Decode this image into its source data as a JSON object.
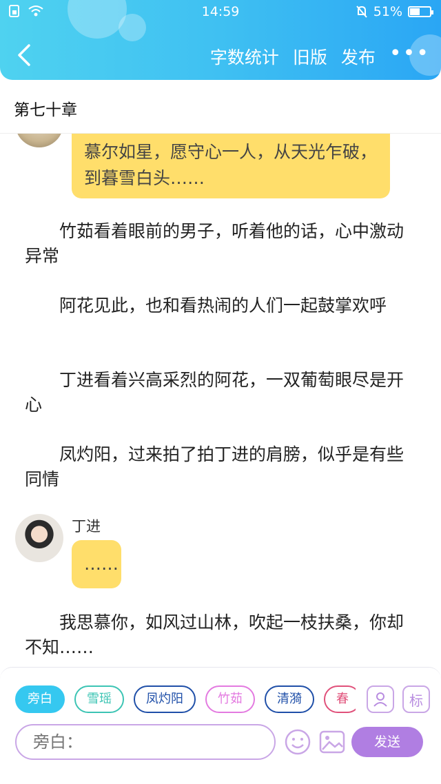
{
  "status_bar": {
    "time": "14:59",
    "battery": "51%",
    "battery_level": 0.51
  },
  "nav": {
    "actions": [
      "字数统计",
      "旧版",
      "发布"
    ],
    "more": "•••"
  },
  "chapter": {
    "title": "第七十章"
  },
  "messages": {
    "first_bubble": "慕尔如星，愿守心一人，从天光乍破，到暮雪白头……",
    "p1": "竹茹看着眼前的男子，听着他的话，心中激动异常",
    "p2": "阿花见此，也和看热闹的人们一起鼓掌欢呼",
    "p3": "丁进看着兴高采烈的阿花，一双葡萄眼尽是开心",
    "p4": "凤灼阳，过来拍了拍丁进的肩膀，似乎是有些同情",
    "speaker": "丁进",
    "speaker_bubble": "……",
    "p5": "我思慕你，如风过山林，吹起一枝扶桑，你却不知……"
  },
  "composer": {
    "chips": [
      {
        "label": "旁白",
        "color": "#35c8f0",
        "active": true
      },
      {
        "label": "雪瑶",
        "color": "#3cc4b4",
        "active": false
      },
      {
        "label": "凤灼阳",
        "color": "#1f4fa8",
        "active": false
      },
      {
        "label": "竹茹",
        "color": "#e37ae0",
        "active": false
      },
      {
        "label": "清漪",
        "color": "#1f4fa8",
        "active": false
      },
      {
        "label": "春",
        "color": "#e0507a",
        "active": false
      }
    ],
    "tag_icon_label": "标",
    "input_placeholder": "旁白：",
    "send_label": "发送"
  }
}
